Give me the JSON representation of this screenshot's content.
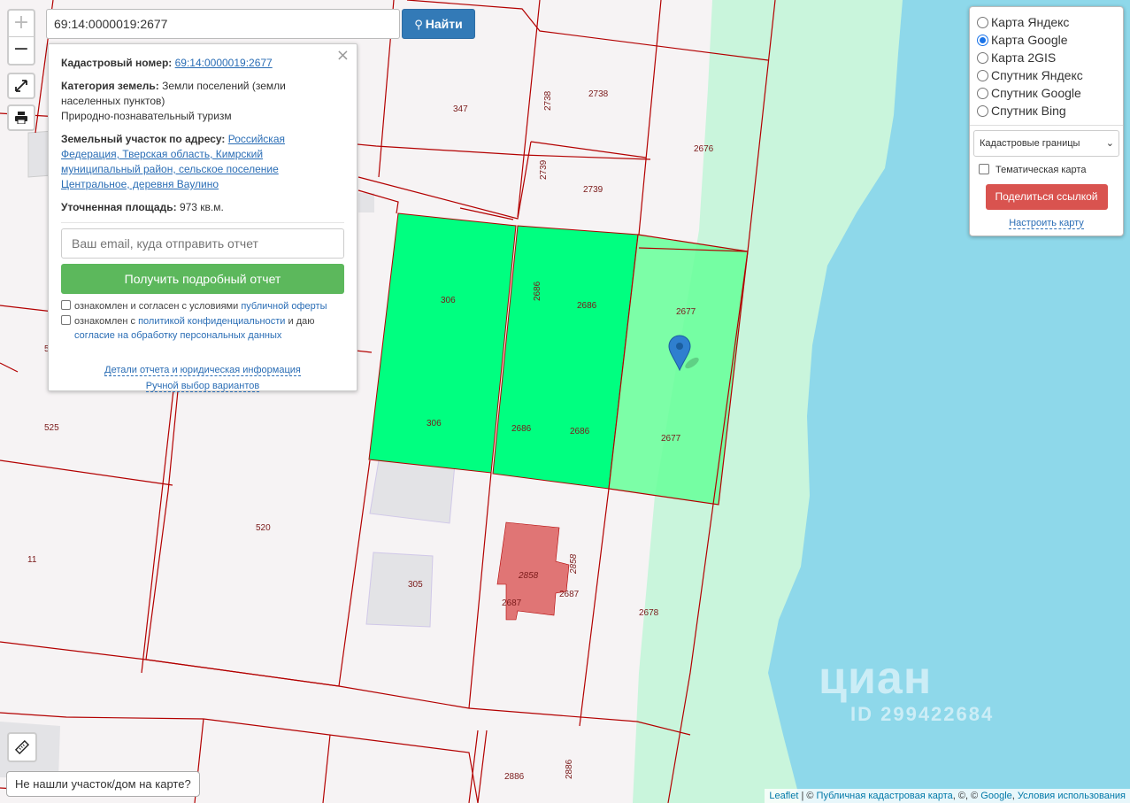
{
  "search": {
    "value": "69:14:0000019:2677",
    "find_label": "Найти"
  },
  "zoom": {
    "in": "+",
    "out": "−"
  },
  "popup": {
    "cadastral_label": "Кадастровый номер:",
    "cadastral_value": "69:14:0000019:2677",
    "category_label": "Категория земель:",
    "category_value": "Земли поселений (земли населенных пунктов)",
    "use_value": "Природно-познавательный туризм",
    "address_label": "Земельный участок по адресу:",
    "address_value": "Российская Федерация, Тверская область, Кимрский муниципальный район, сельское поселение Центральное, деревня Ваулино",
    "area_label": "Уточненная площадь:",
    "area_value": "973 кв.м.",
    "email_placeholder": "Ваш email, куда отправить отчет",
    "report_button": "Получить подробный отчет",
    "consent1_text": "ознакомлен и согласен с условиями ",
    "consent1_link": "публичной оферты",
    "consent2_text": "ознакомлен с ",
    "consent2_link": "политикой конфиденциальности",
    "consent2_mid": " и даю ",
    "consent2_link2": "согласие на обработку персональных данных",
    "details_link": "Детали отчета и юридическая информация",
    "manual_link": "Ручной выбор вариантов"
  },
  "layers": {
    "options": [
      {
        "label": "Карта Яндекс",
        "selected": false
      },
      {
        "label": "Карта Google",
        "selected": true
      },
      {
        "label": "Карта 2GIS",
        "selected": false
      },
      {
        "label": "Спутник Яндекс",
        "selected": false
      },
      {
        "label": "Спутник Google",
        "selected": false
      },
      {
        "label": "Спутник Bing",
        "selected": false
      }
    ],
    "overlay_select": "Кадастровые границы",
    "thematic_label": "Тематическая карта",
    "share_button": "Поделиться ссылкой",
    "setup_link": "Настроить карту"
  },
  "not_found": "Не нашли участок/дом на карте?",
  "watermark": {
    "brand": "циан",
    "id": "ID 299422684"
  },
  "attribution": {
    "leaflet": "Leaflet",
    "sep": " | © ",
    "pkk": "Публичная кадастровая карта",
    "mid": ", ©, © ",
    "google": "Google",
    "comma": ", ",
    "terms": "Условия использования"
  },
  "map": {
    "colors": {
      "water": "#8ed8ea",
      "shore": "#c9f5dc",
      "selected": "#66ff99",
      "neighbor": "#00ff80",
      "building": "#e07575",
      "boundary": "#b30000"
    },
    "parcel_labels": [
      "347",
      "2738",
      "2738",
      "2739",
      "2739",
      "2676",
      "306",
      "2686",
      "2686",
      "2677",
      "306",
      "2686",
      "2686",
      "2677",
      "5",
      "525",
      "520",
      "11",
      "305",
      "2858",
      "2858",
      "2687",
      "2687",
      "2678",
      "2886",
      "2886"
    ]
  }
}
